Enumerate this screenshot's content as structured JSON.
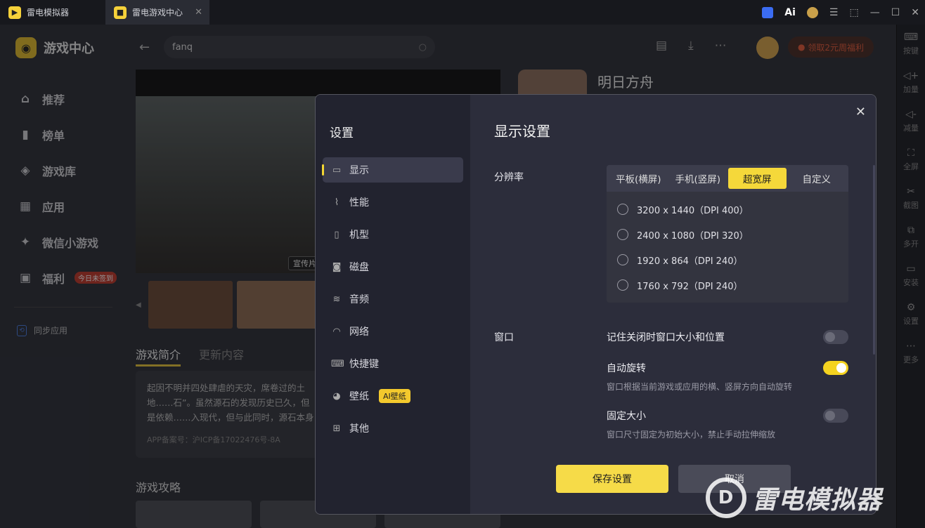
{
  "titlebar": {
    "tab1": "雷电模拟器",
    "tab2": "雷电游戏中心",
    "close": "✕",
    "ai": "Ai",
    "icons": [
      "⬚",
      "—",
      "☐",
      "✕"
    ]
  },
  "app": {
    "brand": "游戏中心",
    "nav": [
      {
        "label": "推荐",
        "icon": "home-icon"
      },
      {
        "label": "榜单",
        "icon": "chart-icon"
      },
      {
        "label": "游戏库",
        "icon": "gamepad-icon"
      },
      {
        "label": "应用",
        "icon": "apps-icon"
      },
      {
        "label": "微信小游戏",
        "icon": "wechat-game-icon"
      },
      {
        "label": "福利",
        "icon": "gift-icon"
      }
    ],
    "welfare_badge": "今日未签到",
    "sync": "同步应用",
    "search_value": "fanq",
    "promo": "领取2元周福利",
    "video_tag": "宣传片",
    "game_title": "明日方舟",
    "tabs": [
      "游戏简介",
      "更新内容"
    ],
    "intro_text": "起因不明并四处肆虐的天灾，席卷过的土地……石”。虽然源石的发现历史已久，但是依赖……入现代，但与此同时，源石本身也催生出“感",
    "icp": "APP备案号：沪ICP备17022476号-8A",
    "guide_title": "游戏攻略"
  },
  "righttool": [
    {
      "label": "按键",
      "icon": "keyboard-icon"
    },
    {
      "label": "加量",
      "icon": "volume-up-icon"
    },
    {
      "label": "减量",
      "icon": "volume-down-icon"
    },
    {
      "label": "全屏",
      "icon": "fullscreen-icon"
    },
    {
      "label": "截图",
      "icon": "scissors-icon"
    },
    {
      "label": "多开",
      "icon": "multi-instance-icon"
    },
    {
      "label": "安装",
      "icon": "install-icon"
    },
    {
      "label": "设置",
      "icon": "gear-icon"
    },
    {
      "label": "更多",
      "icon": "more-icon"
    }
  ],
  "dialog": {
    "sidebar_title": "设置",
    "menu": [
      {
        "label": "显示",
        "active": true
      },
      {
        "label": "性能"
      },
      {
        "label": "机型"
      },
      {
        "label": "磁盘"
      },
      {
        "label": "音频"
      },
      {
        "label": "网络"
      },
      {
        "label": "快捷键"
      },
      {
        "label": "壁纸",
        "badge": "AI壁纸"
      },
      {
        "label": "其他"
      }
    ],
    "title": "显示设置",
    "resolution_label": "分辨率",
    "segments": [
      "平板(横屏)",
      "手机(竖屏)",
      "超宽屏",
      "自定义"
    ],
    "selected_segment": "超宽屏",
    "resolutions": [
      "3200 x 1440（DPI 400）",
      "2400 x 1080（DPI 320）",
      "1920 x 864（DPI 240）",
      "1760 x 792（DPI 240）"
    ],
    "window_label": "窗口",
    "options": [
      {
        "title": "记住关闭时窗口大小和位置",
        "desc": "",
        "on": false
      },
      {
        "title": "自动旋转",
        "desc": "窗口根据当前游戏或应用的横、竖屏方向自动旋转",
        "on": true
      },
      {
        "title": "固定大小",
        "desc": "窗口尺寸固定为初始大小，禁止手动拉伸缩放",
        "on": false
      }
    ],
    "save": "保存设置",
    "cancel": "取消"
  },
  "watermark": "雷电模拟器",
  "colors": {
    "accent": "#f5d83a",
    "bg": "#2c2d3b"
  }
}
